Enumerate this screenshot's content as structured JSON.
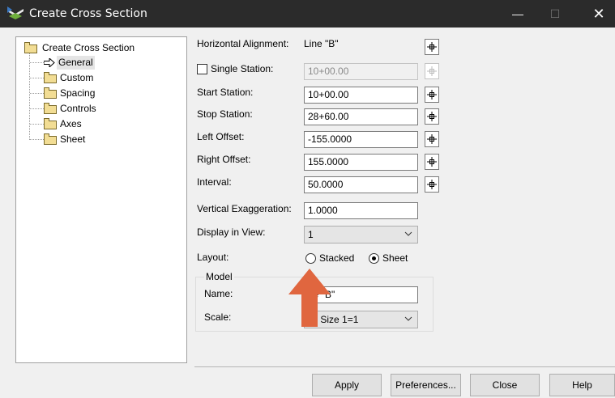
{
  "window": {
    "title": "Create Cross Section",
    "minimize": "—",
    "maximize": "☐",
    "close": "✕"
  },
  "tree": {
    "root": "Create Cross Section",
    "items": [
      {
        "label": "General",
        "selected": true
      },
      {
        "label": "Custom"
      },
      {
        "label": "Spacing"
      },
      {
        "label": "Controls"
      },
      {
        "label": "Axes"
      },
      {
        "label": "Sheet"
      }
    ]
  },
  "form": {
    "horizontal_alignment": {
      "label": "Horizontal Alignment:",
      "value": "Line \"B\""
    },
    "single_station": {
      "label": "Single Station:",
      "value": "10+00.00",
      "checked": false,
      "enabled": false
    },
    "start_station": {
      "label": "Start Station:",
      "value": "10+00.00"
    },
    "stop_station": {
      "label": "Stop Station:",
      "value": "28+60.00"
    },
    "left_offset": {
      "label": "Left Offset:",
      "value": "-155.0000"
    },
    "right_offset": {
      "label": "Right Offset:",
      "value": "155.0000"
    },
    "interval": {
      "label": "Interval:",
      "value": "50.0000"
    },
    "vertical_exaggeration": {
      "label": "Vertical Exaggeration:",
      "value": "1.0000"
    },
    "display_in_view": {
      "label": "Display in View:",
      "value": "1"
    },
    "layout": {
      "label": "Layout:",
      "options": [
        "Stacked",
        "Sheet"
      ],
      "selected": "Sheet"
    }
  },
  "model": {
    "group_label": "Model",
    "name_label": "Name:",
    "name_value": "ne \"B\"",
    "scale_label": "Scale:",
    "scale_value": "ull Size 1=1"
  },
  "buttons": {
    "apply": "Apply",
    "preferences": "Preferences...",
    "close": "Close",
    "help": "Help"
  },
  "colors": {
    "titlebar": "#2b2b2b",
    "dialog_bg": "#f0f0f0",
    "annotation_arrow": "#e0663f"
  }
}
